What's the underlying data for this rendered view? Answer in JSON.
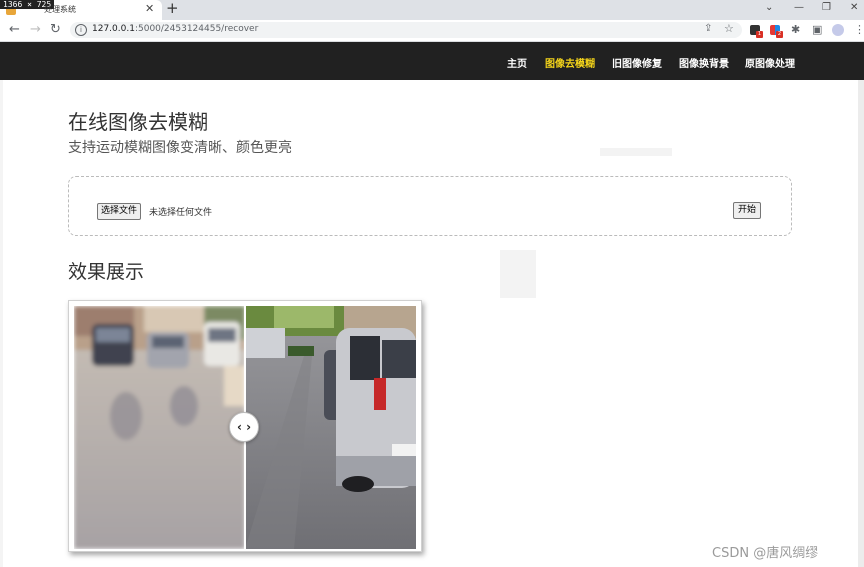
{
  "browser": {
    "screen_dims": "1366 × 725",
    "tab_title": "处理系统",
    "url_host": "127.0.0.1",
    "url_path": ":5000/2453124455/recover",
    "ext_badge_1": "1",
    "ext_badge_2": "2"
  },
  "nav": {
    "items": [
      "主页",
      "图像去模糊",
      "旧图像修复",
      "图像换背景",
      "原图像处理"
    ],
    "active_index": 1,
    "active_color": "#f3d31a",
    "bg_color": "#212121"
  },
  "page": {
    "title": "在线图像去模糊",
    "subtitle": "支持运动模糊图像变清晰、颜色更亮",
    "file_button": "选择文件",
    "file_status": "未选择任何文件",
    "start_button": "开始",
    "result_title": "效果展示",
    "handle_icon": "‹ ›"
  },
  "watermark": "CSDN @唐风绸缪"
}
